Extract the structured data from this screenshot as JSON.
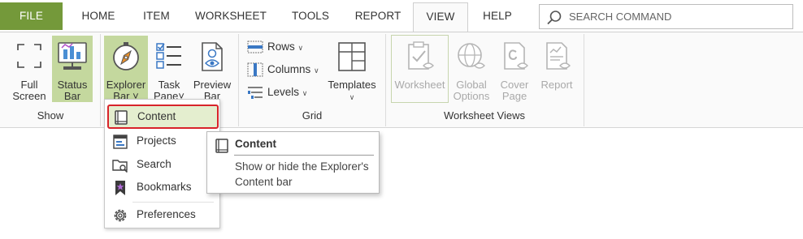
{
  "menubar": {
    "file": "FILE",
    "tabs": [
      {
        "label": "HOME"
      },
      {
        "label": "ITEM"
      },
      {
        "label": "WORKSHEET"
      },
      {
        "label": "TOOLS"
      },
      {
        "label": "REPORT"
      },
      {
        "label": "VIEW"
      },
      {
        "label": "HELP"
      }
    ],
    "search_placeholder": "SEARCH COMMAND"
  },
  "ribbon": {
    "show": {
      "label": "Show",
      "full_screen": "Full\nScreen",
      "status_bar": "Status\nBar"
    },
    "explorer": {
      "explorer_bar": "Explorer\nBar ˅",
      "task_pane": "Task\nPane˅",
      "preview_bar": "Preview\nBar"
    },
    "grid": {
      "label": "Grid",
      "rows": "Rows",
      "columns": "Columns",
      "levels": "Levels",
      "templates": "Templates"
    },
    "worksheet_views": {
      "label": "Worksheet Views",
      "worksheet": "Worksheet",
      "global_options": "Global\nOptions",
      "cover_page": "Cover\nPage",
      "report": "Report"
    }
  },
  "dropdown": {
    "items": [
      {
        "label": "Content"
      },
      {
        "label": "Projects"
      },
      {
        "label": "Search"
      },
      {
        "label": "Bookmarks"
      },
      {
        "label": "Preferences"
      }
    ]
  },
  "tooltip": {
    "title": "Content",
    "description": "Show or hide the Explorer's Content bar"
  },
  "colors": {
    "accent_green": "#74993a",
    "selected_bg": "#c4d89e",
    "highlight_border": "#d8232a"
  }
}
